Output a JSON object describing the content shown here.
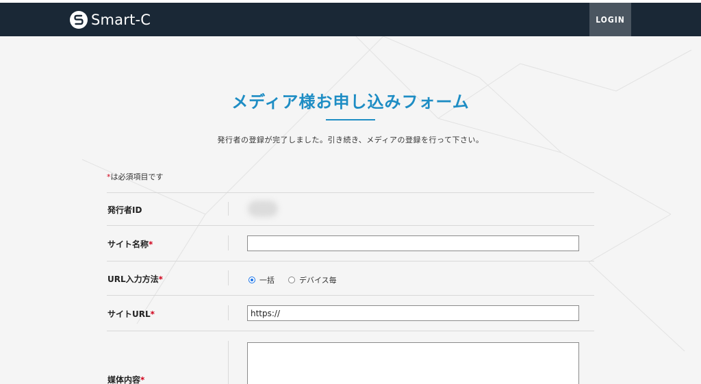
{
  "header": {
    "logo_text": "Smart-C",
    "login_label": "LOGIN"
  },
  "page": {
    "title": "メディア様お申し込みフォーム",
    "lead": "発行者の登録が完了しました。引き続き、メディアの登録を行って下さい。",
    "required_note": "は必須項目です",
    "required_mark": "*"
  },
  "form": {
    "publisher_id_label": "発行者ID",
    "site_name_label": "サイト名称",
    "url_method_label": "URL入力方法",
    "url_method_options": [
      "一括",
      "デバイス毎"
    ],
    "url_method_selected": "一括",
    "site_url_label": "サイトURL",
    "site_url_value": "https://",
    "media_content_label": "媒体内容"
  },
  "colors": {
    "header_bg": "#1a2836",
    "accent": "#1e8dc4",
    "required": "#d0021b"
  }
}
